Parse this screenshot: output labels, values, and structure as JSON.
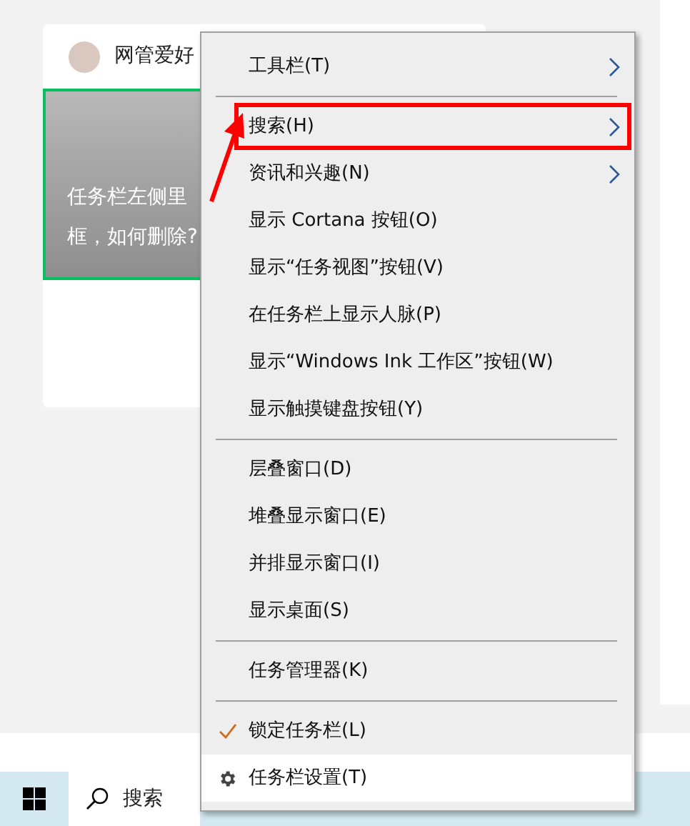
{
  "card": {
    "author": "网管爱好",
    "caption_lines": [
      "任务栏左侧里",
      "框，如何删除?"
    ]
  },
  "context_menu": {
    "items": [
      {
        "kind": "submenu",
        "label": "工具栏(T)",
        "hovered": false,
        "highlighted": false
      },
      {
        "kind": "separator"
      },
      {
        "kind": "submenu",
        "label": "搜索(H)",
        "hovered": false,
        "highlighted": true
      },
      {
        "kind": "submenu",
        "label": "资讯和兴趣(N)",
        "hovered": false,
        "highlighted": false
      },
      {
        "kind": "item",
        "label": "显示 Cortana 按钮(O)",
        "hovered": false,
        "highlighted": false
      },
      {
        "kind": "item",
        "label": "显示“任务视图”按钮(V)",
        "hovered": false,
        "highlighted": false
      },
      {
        "kind": "item",
        "label": "在任务栏上显示人脉(P)",
        "hovered": false,
        "highlighted": false
      },
      {
        "kind": "item",
        "label": "显示“Windows Ink 工作区”按钮(W)",
        "hovered": false,
        "highlighted": false
      },
      {
        "kind": "item",
        "label": "显示触摸键盘按钮(Y)",
        "hovered": false,
        "highlighted": false
      },
      {
        "kind": "separator"
      },
      {
        "kind": "item",
        "label": "层叠窗口(D)",
        "hovered": false,
        "highlighted": false
      },
      {
        "kind": "item",
        "label": "堆叠显示窗口(E)",
        "hovered": false,
        "highlighted": false
      },
      {
        "kind": "item",
        "label": "并排显示窗口(I)",
        "hovered": false,
        "highlighted": false
      },
      {
        "kind": "item",
        "label": "显示桌面(S)",
        "hovered": false,
        "highlighted": false
      },
      {
        "kind": "separator"
      },
      {
        "kind": "item",
        "label": "任务管理器(K)",
        "hovered": false,
        "highlighted": false
      },
      {
        "kind": "separator"
      },
      {
        "kind": "check",
        "label": "锁定任务栏(L)",
        "checked": true,
        "hovered": false,
        "highlighted": false
      },
      {
        "kind": "settings",
        "label": "任务栏设置(T)",
        "hovered": true,
        "highlighted": false
      }
    ]
  },
  "taskbar": {
    "search_placeholder": "搜索"
  }
}
